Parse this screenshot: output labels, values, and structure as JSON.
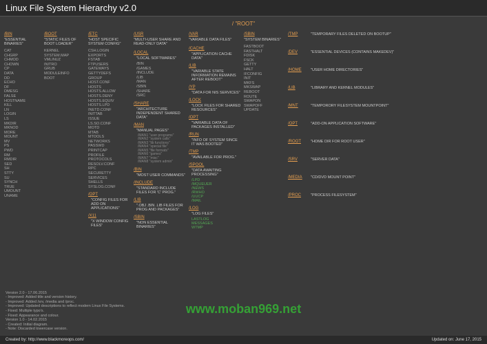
{
  "title": "Linux File System Hierarchy v2.0",
  "root": "/ \"ROOT\"",
  "footer_left": "Created by: http://www.blackmoreops.com/",
  "footer_right": "Updated on: June 17, 2015",
  "watermark": "www.moban969.net",
  "bin": {
    "title": "/BIN",
    "desc": "\"ESSENTIAL BINARIES\"",
    "items": [
      "CAT",
      "CHGRP",
      "CHMOD",
      "CHOWN",
      "CP",
      "DATA",
      "DD",
      "ECHO",
      "DF",
      "DMESG",
      "FALSE",
      "HOSTNAME",
      "KILL",
      "LN",
      "LOGIN",
      "LS",
      "MKDIR",
      "MKNOD",
      "MORE",
      "MOUNT",
      "MV",
      "PS",
      "PWD",
      "RM",
      "RMDIR",
      "SED",
      "SH",
      "STTY",
      "SU",
      "SYNCH",
      "TRUE",
      "UMOUNT",
      "UNAME"
    ]
  },
  "boot": {
    "title": "/BOOT",
    "desc": "\"STATIC FILES OF BOOT LOADER\"",
    "items": [
      "KERNEL",
      "SYSTEM.MAP",
      "VMLINUZ",
      "INITRO",
      "GRUB",
      "MODULEINFO",
      "BOOT"
    ]
  },
  "etc": {
    "title": "/ETC",
    "desc": "\"HOST SPECIFIC SYSTEM CONFIG\"",
    "items": [
      "CSH.LOGIN",
      "EXPORTS",
      "FSTAB",
      "FTPUSERS",
      "GATEWAYS",
      "GETTYDEFS",
      "GROUP",
      "HOST.CONF",
      "HOSTS",
      "HOSTS.ALLOW",
      "HOSTS.DENY",
      "HOSTS.EQUIV",
      "HOSTS.LPD",
      "INETD.CONF",
      "INITTAB",
      "ISSUE",
      "LS.SO.CONF",
      "MOTD",
      "MTAB",
      "MTOOLS",
      "NETWORKS",
      "PASSWD",
      "PRINTCAP",
      "PROFILE",
      "PROTOCOLS",
      "RESOLV.CONF",
      "RPC",
      "SECURETTY",
      "SERVICES",
      "SHELLS",
      "SYSLOG.CONF"
    ],
    "opt": {
      "title": "/OPT",
      "desc": "\"CONFIG FILES FOR ADD ON APPLICATIONS\""
    },
    "x11": {
      "title": "/X11",
      "desc": "\"X WINDOW CONFIG FILES\""
    }
  },
  "usr": {
    "title": "/USR",
    "desc": "\"MULTI-USER SHARE AND READ-ONLY DATA\"",
    "local": {
      "title": "/LOCAL",
      "desc": "\"LOCAL SOFTWARES\"",
      "items": [
        "/BIN",
        "/GAMES",
        "/INCLUDE",
        "/LIB",
        "/MAN",
        "/SBIN",
        "/SHARE",
        "/SRC"
      ]
    },
    "share": {
      "title": "/SHARE",
      "desc": "\"ARCHITECTURE INDEPENDENT SHARED DATA\""
    },
    "man": {
      "title": "/MAN",
      "desc": "\"MANUAL PAGES\"",
      "items": [
        "/MAN1 \"user programs\"",
        "/MAN2 \"system calls\"",
        "/MAN3 \"lib functions\"",
        "/MAN4 \"special file\"",
        "/MAN5 \"file formats\"",
        "/MAN6 \"games\"",
        "/MAN7 \"misc\"",
        "/MAN8 \"system admin\""
      ]
    },
    "bin": {
      "title": "/BIN",
      "desc": "\"MOST USER COMMANDS\""
    },
    "include": {
      "title": "/INCLUDE",
      "desc": "\"STANDARD INCLUDE FILES FOR 'C' PROG.\""
    },
    "lib": {
      "title": "/LIB",
      "desc": "\".OBJ .BIN .LIB FILES FOR PROG AND PACKAGES\""
    },
    "sbin": {
      "title": "/SBIN",
      "desc": "\"NON ESSENTIAL BINARIES\""
    }
  },
  "var": {
    "title": "/VAR",
    "desc": "\"VARIABLE DATA FILES\"",
    "cache": {
      "title": "/CACHE",
      "desc": "\"APPLICATION CACHE DATA\""
    },
    "lib": {
      "title": "/LIB",
      "desc": "\"VARIABLE STATE INFORMATION REMAINS AFTER REBOOT\""
    },
    "yp": {
      "title": "/YP",
      "desc": "\"DATA FOR NIS SERVICES\""
    },
    "lock": {
      "title": "/LOCK",
      "desc": "\"LOCK FILES FOR SHARED RESOURCES\""
    },
    "opt": {
      "title": "/OPT",
      "desc": "\"VARIABLE DATA OF PACKAGES INSTALLED\""
    },
    "run": {
      "title": "/RUN",
      "desc": "\"INFO OF SYSTEM SINCE IT WAS BOOTED\""
    },
    "tmp": {
      "title": "/TMP",
      "desc": "\"AVAILABLE FOR PROG.\""
    },
    "spool": {
      "title": "/SPOOL",
      "desc": "\"DATA AWAITING PROCESSING\"",
      "items": [
        "/LPD",
        "/MQUEUER",
        "/NEWS",
        "/RWHO",
        "/UUCP",
        "/MAIL"
      ]
    },
    "log": {
      "title": "/LOG",
      "desc": "\"LOG FILES\"",
      "items": [
        "LASTLOG",
        "MESSAGES",
        "WTMP"
      ]
    }
  },
  "sbin": {
    "title": "/SBIN",
    "desc": "\"SYSTEM BINARIES\"",
    "items": [
      "FASTBOOT",
      "FASTHALT",
      "FDISK",
      "FSCK",
      "GETTY",
      "HALT",
      "IFCONFIG",
      "INIT",
      "MKFS",
      "MKSWAP",
      "REBOOT",
      "ROUTE",
      "SWAPON",
      "SWAPOFF",
      "UPDATE"
    ]
  },
  "right": [
    {
      "title": "/TMP",
      "desc": "\"TEMPORARY FILES DELETED ON BOOTUP\""
    },
    {
      "title": "/DEV",
      "desc": "\"ESSENTIAL DEVICES (CONTAINS MAKEDEV)\""
    },
    {
      "title": "/HOME",
      "desc": "\"USER HOME DIRECTORIES\""
    },
    {
      "title": "/LIB",
      "desc": "\"LIBRARY AND KERNEL MODULES\""
    },
    {
      "title": "/MNT",
      "desc": "\"TEMPORORY FILESYSTEM MOUNTPOINT\""
    },
    {
      "title": "/OPT",
      "desc": "\"ADD-ON APPLICATION SOFTWARE\""
    },
    {
      "title": "/ROOT",
      "desc": "\"HOME DIR FOR ROOT USER\""
    },
    {
      "title": "/SRV",
      "desc": "\"SERVER DATA\""
    },
    {
      "title": "/MEDIA",
      "desc": "\"CD/DVD MOUNT POINT\""
    },
    {
      "title": "/PROC",
      "desc": "\"PROCESS FILESYSTEM\""
    }
  ],
  "notes": [
    "Version 2.0 - 17.06.2015",
    "- Improved: Added title and version history.",
    "- Improved: Added /srv, /media and /proc.",
    "- Improved: Updated descriptions to reflect modern Linux File Systems.",
    "- Fixed: Multiple typo's.",
    "- Fixed: Appearance and colour.",
    "Version 1.0 - 14.02.2015",
    "- Created: Initial diagram.",
    "- Note: Discarded lowercase version."
  ]
}
